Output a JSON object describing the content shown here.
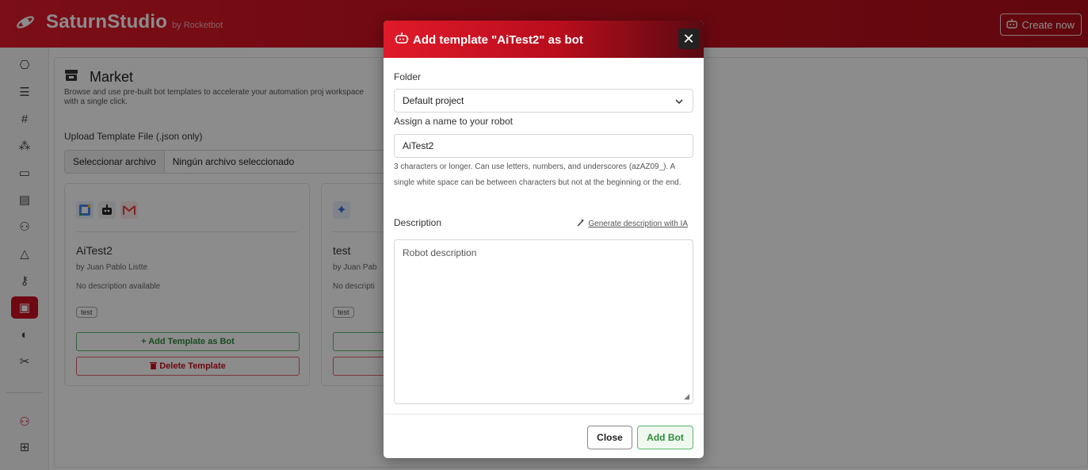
{
  "app": {
    "name": "SaturnStudio",
    "by": "by Rocketbot",
    "create_now": "Create now"
  },
  "sidebar": {
    "items": [
      {
        "icon": "robot-icon"
      },
      {
        "icon": "list-icon"
      },
      {
        "icon": "hash-icon"
      },
      {
        "icon": "nodes-icon"
      },
      {
        "icon": "layout-icon"
      },
      {
        "icon": "database-icon"
      },
      {
        "icon": "users-icon"
      },
      {
        "icon": "network-icon"
      },
      {
        "icon": "key-icon"
      },
      {
        "icon": "store-icon"
      },
      {
        "icon": "saturn-icon"
      },
      {
        "icon": "tools-icon"
      },
      {
        "icon": "team-icon"
      },
      {
        "icon": "sitemap-icon"
      }
    ]
  },
  "market": {
    "title": "Market",
    "description": "Browse and use pre-built bot templates to accelerate your automation proj workspace with a single click.",
    "upload_label": "Upload Template File (.json only)",
    "file_button": "Seleccionar archivo",
    "file_status": "Ningún archivo seleccionado"
  },
  "cards": [
    {
      "name": "AiTest2",
      "author": "by Juan Pablo Listte",
      "description": "No description available",
      "tag": "test",
      "add_label": "+ Add Template as Bot",
      "delete_label": "Delete Template"
    },
    {
      "name": "test",
      "author": "by Juan Pab",
      "description": "No descripti",
      "tag": "test",
      "add_label": "",
      "delete_label": ""
    }
  ],
  "modal": {
    "title": "Add template \"AiTest2\" as bot",
    "folder_label": "Folder",
    "folder_value": "Default project",
    "name_label": "Assign a name to your robot",
    "name_value": "AiTest2",
    "help": "3 characters or longer. Can use letters, numbers, and underscores (azAZ09_). A single white space can be between characters but not at the beginning or the end.",
    "description_label": "Description",
    "generate_label": "Generate description with IA",
    "description_placeholder": "Robot description",
    "close_label": "Close",
    "add_label": "Add Bot"
  },
  "colors": {
    "brand": "#c8101f",
    "success": "#2f8b3d"
  }
}
